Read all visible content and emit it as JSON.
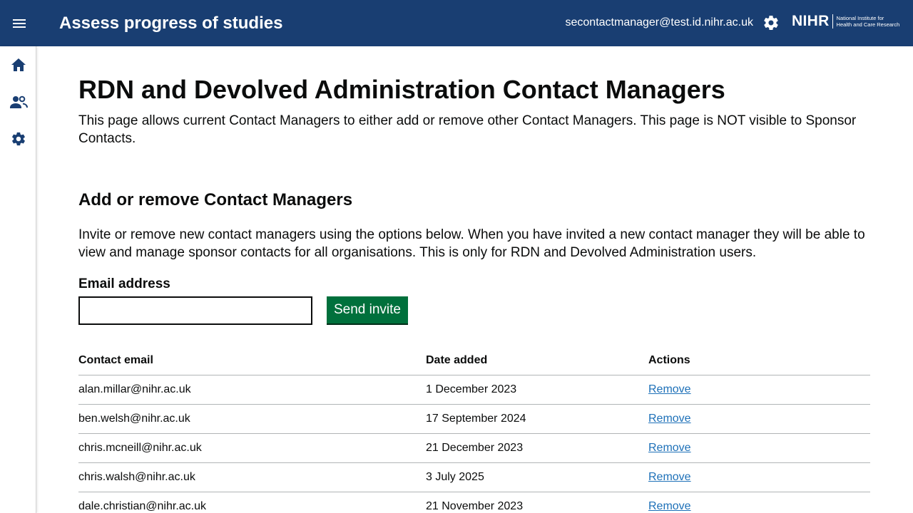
{
  "header": {
    "app_title": "Assess progress of studies",
    "user_email": "secontactmanager@test.id.nihr.ac.uk",
    "logo_main": "NIHR",
    "logo_sub_line1": "National Institute for",
    "logo_sub_line2": "Health and Care Research",
    "icons": [
      "menu-icon",
      "gear-icon"
    ]
  },
  "sidebar": {
    "items": [
      {
        "icon": "home-icon"
      },
      {
        "icon": "people-icon"
      },
      {
        "icon": "gear-icon"
      }
    ]
  },
  "main": {
    "page_title": "RDN and Devolved Administration Contact Managers",
    "intro": "This page allows current Contact Managers to either add or remove other Contact Managers. This page is NOT visible to Sponsor Contacts.",
    "section_title": "Add or remove Contact Managers",
    "section_text": "Invite or remove new contact managers using the options below. When you have invited a new contact manager they will be able to view and manage sponsor contacts for all organisations. This is only for RDN and Devolved Administration users.",
    "email_label": "Email address",
    "email_value": "",
    "invite_button": "Send invite"
  },
  "table": {
    "headers": [
      "Contact email",
      "Date added",
      "Actions"
    ],
    "rows": [
      {
        "email": "alan.millar@nihr.ac.uk",
        "date": "1 December 2023",
        "action": "Remove"
      },
      {
        "email": "ben.welsh@nihr.ac.uk",
        "date": "17 September 2024",
        "action": "Remove"
      },
      {
        "email": "chris.mcneill@nihr.ac.uk",
        "date": "21 December 2023",
        "action": "Remove"
      },
      {
        "email": "chris.walsh@nihr.ac.uk",
        "date": "3 July 2025",
        "action": "Remove"
      },
      {
        "email": "dale.christian@nihr.ac.uk",
        "date": "21 November 2023",
        "action": "Remove"
      }
    ]
  },
  "colors": {
    "header_bg": "#193e72",
    "button_green": "#00703c",
    "link_blue": "#1d70b8",
    "sidebar_icon": "#193e72"
  }
}
